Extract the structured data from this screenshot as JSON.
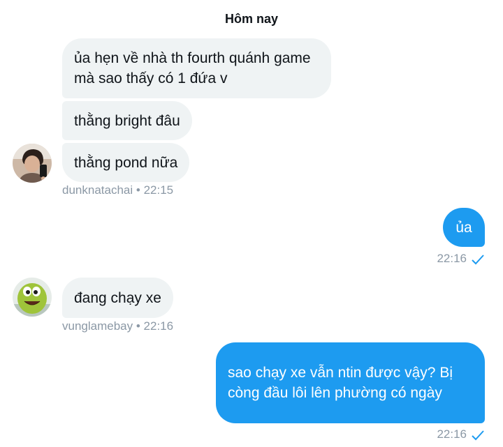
{
  "day_label": "Hôm nay",
  "group1": {
    "messages": [
      "ủa hẹn về nhà th fourth quánh game mà sao thấy có 1 đứa v",
      "thằng bright đâu",
      "thằng pond nữa"
    ],
    "sender": "dunknatachai",
    "time": "22:15"
  },
  "msg_out1": {
    "text": "ủa",
    "time": "22:16"
  },
  "group2": {
    "message": "đang chạy xe",
    "sender": "vunglamebay",
    "time": "22:16"
  },
  "msg_out2": {
    "text": "sao chạy xe vẫn ntin được vậy? Bị còng đầu lôi lên phường có ngày",
    "time": "22:16"
  },
  "meta_separator": "•",
  "icons": {
    "sent": "check-icon",
    "avatar1": "avatar-photo-person",
    "avatar2": "avatar-green-creature"
  },
  "colors": {
    "outgoing_bubble": "#1d9bf0",
    "incoming_bubble": "#eff3f4",
    "meta_text": "#8b98a5"
  }
}
